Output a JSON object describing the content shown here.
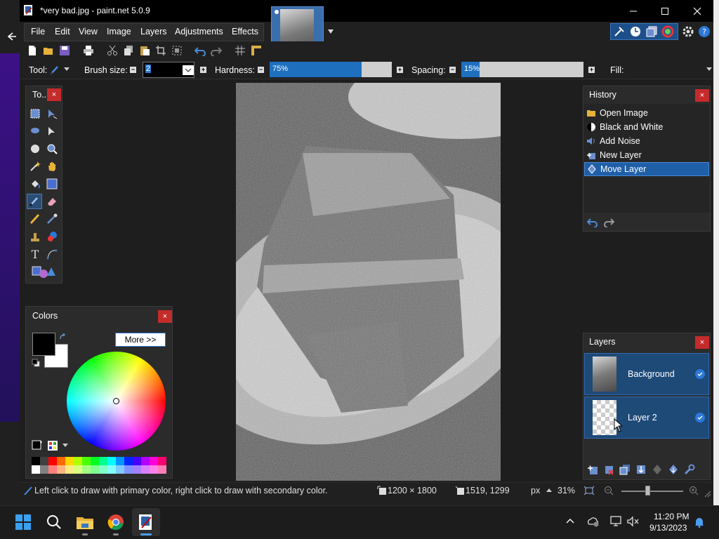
{
  "window": {
    "title": "*very bad.jpg - paint.net 5.0.9"
  },
  "menu": [
    "File",
    "Edit",
    "View",
    "Image",
    "Layers",
    "Adjustments",
    "Effects"
  ],
  "toolbar": {
    "tool_label": "Tool:",
    "brush_size_label": "Brush size:",
    "brush_size_value": "2",
    "hardness_label": "Hardness:",
    "hardness_value": "75%",
    "hardness_fraction": 0.75,
    "spacing_label": "Spacing:",
    "spacing_value": "15%",
    "spacing_fraction": 0.15,
    "fill_label": "Fill:"
  },
  "tools_panel": {
    "title": "To..."
  },
  "colors_panel": {
    "title": "Colors",
    "more_button": "More >>",
    "primary_color": "#000000",
    "secondary_color": "#ffffff",
    "palette": [
      "#000000",
      "#404040",
      "#ff0000",
      "#ff6a00",
      "#ffd800",
      "#b6ff00",
      "#4cff00",
      "#00ff21",
      "#00ff90",
      "#00ffff",
      "#0094ff",
      "#0026ff",
      "#4800ff",
      "#b200ff",
      "#ff00dc",
      "#ff006e"
    ]
  },
  "history_panel": {
    "title": "History",
    "items": [
      {
        "label": "Open Image",
        "icon": "folder-icon"
      },
      {
        "label": "Black and White",
        "icon": "black-white-icon"
      },
      {
        "label": "Add Noise",
        "icon": "noise-icon"
      },
      {
        "label": "New Layer",
        "icon": "new-layer-icon"
      },
      {
        "label": "Move Layer",
        "icon": "move-layer-icon"
      }
    ],
    "selected_index": 4
  },
  "layers_panel": {
    "title": "Layers",
    "layers": [
      {
        "name": "Background",
        "visible": true
      },
      {
        "name": "Layer 2",
        "visible": true
      }
    ]
  },
  "statusbar": {
    "hint": "Left click to draw with primary color, right click to draw with secondary color.",
    "image_size": "1200 × 1800",
    "cursor_pos": "1519, 1299",
    "units": "px",
    "zoom": "31%"
  },
  "taskbar": {
    "time": "11:20 PM",
    "date": "9/13/2023"
  },
  "colors": {
    "accent": "#1f6fbf",
    "title_bar": "#000000",
    "panel_bg": "#2b2b2b",
    "close_red": "#c42b2b"
  }
}
